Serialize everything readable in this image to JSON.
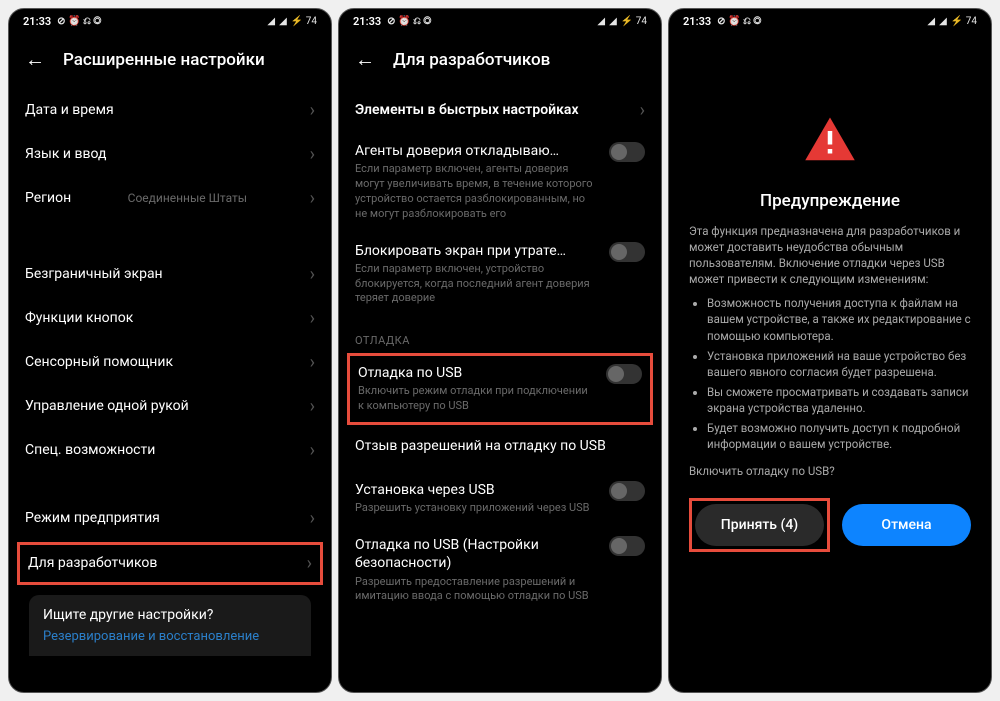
{
  "statusbar": {
    "time": "21:33",
    "icons_left": "⊘ ⏰ 🌐 @",
    "icons_right": "📶 📶 ⚡",
    "battery": "74"
  },
  "screen1": {
    "title": "Расширенные настройки",
    "items": {
      "datetime": "Дата и время",
      "lang": "Язык и ввод",
      "region_label": "Регион",
      "region_value": "Соединенные Штаты",
      "edgeless": "Безграничный экран",
      "buttons": "Функции кнопок",
      "touch_assist": "Сенсорный помощник",
      "one_hand": "Управление одной рукой",
      "accessibility": "Спец. возможности",
      "enterprise": "Режим предприятия",
      "devs": "Для разработчиков"
    },
    "bottom": {
      "title": "Ищите другие настройки?",
      "link": "Резервирование и восстановление"
    }
  },
  "screen2": {
    "title": "Для разработчиков",
    "row1": "Элементы в быстрых настройках",
    "trust": {
      "title": "Агенты доверия откладываю…",
      "desc": "Если параметр включен, агенты доверия могут увеличивать время, в течение которого устройство остается разблокированным, но не могут разблокировать его"
    },
    "lock": {
      "title": "Блокировать экран при утрате…",
      "desc": "Если параметр включен, устройство блокируется, когда последний агент доверия теряет доверие"
    },
    "section_debug": "ОТЛАДКА",
    "usb_debug": {
      "title": "Отладка по USB",
      "desc": "Включить режим отладки при подключении к компьютеру по USB"
    },
    "revoke": "Отзыв разрешений на отладку по USB",
    "install": {
      "title": "Установка через USB",
      "desc": "Разрешить установку приложений через USB"
    },
    "security": {
      "title": "Отладка по USB (Настройки безопасности)",
      "desc": "Разрешить предоставление разрешений и имитацию ввода с помощью отладки по USB"
    }
  },
  "screen3": {
    "title": "Предупреждение",
    "intro": "Эта функция предназначена для разработчиков и может доставить неудобства обычным пользователям. Включение отладки через USB может привести к следующим изменениям:",
    "bullets": [
      "Возможность получения доступа к файлам на вашем устройстве, а также их редактирование с помощью компьютера.",
      "Установка приложений на ваше устройство без вашего явного согласия будет разрешена.",
      "Вы сможете просматривать и создавать записи экрана устройства удаленно.",
      "Будет возможно получить доступ к подробной информации о вашем устройстве."
    ],
    "question": "Включить отладку по USB?",
    "btn_accept": "Принять (4)",
    "btn_cancel": "Отмена"
  }
}
